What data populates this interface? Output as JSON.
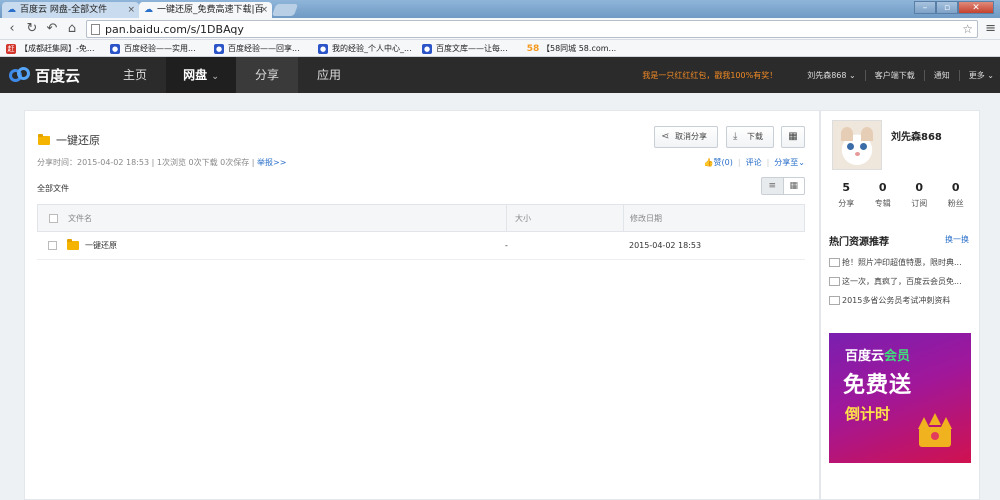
{
  "browser": {
    "tabs": [
      {
        "title": "百度云 网盘-全部文件",
        "close": "×"
      },
      {
        "title": "一键还原_免费高速下载|百",
        "close": "×"
      }
    ],
    "window_controls": {
      "minimize": "–",
      "maximize": "▫",
      "close": "✕"
    },
    "nav": {
      "back": "‹",
      "reload": "↻",
      "undo": "↶",
      "home": "⌂"
    },
    "url": "pan.baidu.com/s/1DBAqy",
    "star": "☆",
    "menu": "≡",
    "bookmarks": [
      {
        "label": "【成都赶集网】-免...",
        "icon": "赶",
        "color": "#d2342a"
      },
      {
        "label": "百度经验——实用...",
        "icon": "🐾",
        "color": "#2b54c8"
      },
      {
        "label": "百度经验——回享...",
        "icon": "🐾",
        "color": "#2b54c8"
      },
      {
        "label": "我的经验_个人中心_...",
        "icon": "🐾",
        "color": "#2b54c8"
      },
      {
        "label": "百度文库——让每...",
        "icon": "🐾",
        "color": "#2b54c8"
      },
      {
        "label": "【58同城 58.com...",
        "icon": "58",
        "color": "#f39a1e"
      }
    ]
  },
  "site": {
    "logo_text": "百度云",
    "nav": [
      "主页",
      "网盘",
      "分享",
      "应用"
    ],
    "nav_arrow": "⌄",
    "promo": "我是一只红红红包，戳我100%有奖！",
    "user": "刘先森868",
    "user_arrow": "⌄",
    "links": [
      "客户端下载",
      "通知",
      "更多"
    ],
    "more_arrow": "⌄"
  },
  "share": {
    "title": "一键还原",
    "cancel_share": "取消分享",
    "download": "下载",
    "qr": "▦",
    "meta": "分享时间：2015-04-02 18:53 | 1次浏览 0次下载 0次保存 | ",
    "report": "举报>>",
    "like": "赞(0)",
    "comment": "评论",
    "share_to": "分享至",
    "share_arrow": "⌄",
    "all_files": "全部文件",
    "view_list": "≡",
    "view_grid": "▦",
    "columns": {
      "name": "文件名",
      "size": "大小",
      "date": "修改日期"
    },
    "rows": [
      {
        "name": "一键还原",
        "size": "-",
        "date": "2015-04-02 18:53"
      }
    ]
  },
  "profile": {
    "name": "刘先森868",
    "stats": [
      {
        "num": "5",
        "label": "分享"
      },
      {
        "num": "0",
        "label": "专辑"
      },
      {
        "num": "0",
        "label": "订阅"
      },
      {
        "num": "0",
        "label": "粉丝"
      }
    ],
    "hot_title": "热门资源推荐",
    "hot_refresh": "换一换",
    "hot_items": [
      "抢！照片冲印超值特惠，限时典...",
      "这一次，真疯了，百度云会员免...",
      "2015多省公务员考试冲刺资料"
    ],
    "ad": {
      "line1": "百度云",
      "line1_vip": "会员",
      "line2": "免费送",
      "line3": "倒计时"
    }
  },
  "colors": {
    "accent": "#2a6fc9",
    "header_bg": "#2b2b2b",
    "promo": "#f08a24",
    "folder": "#f4b400"
  }
}
